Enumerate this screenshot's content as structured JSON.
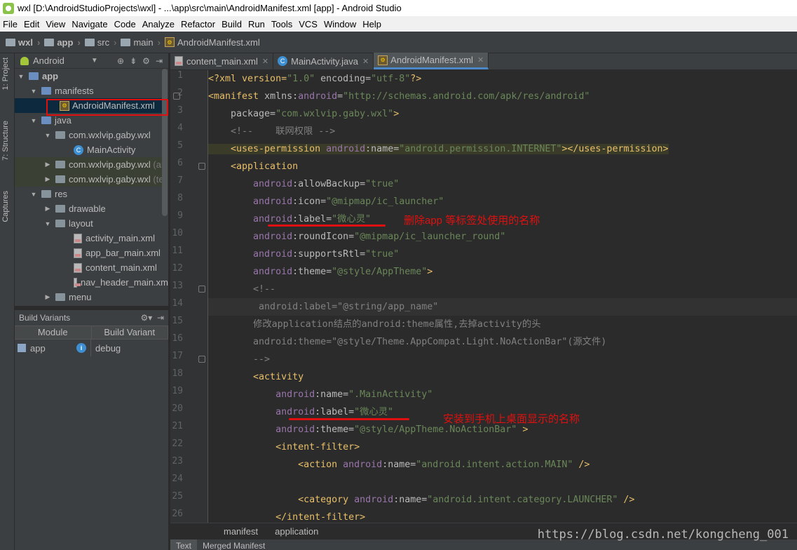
{
  "window": {
    "title": "wxl [D:\\AndroidStudioProjects\\wxl] - ...\\app\\src\\main\\AndroidManifest.xml [app] - Android Studio"
  },
  "menu": [
    "File",
    "Edit",
    "View",
    "Navigate",
    "Code",
    "Analyze",
    "Refactor",
    "Build",
    "Run",
    "Tools",
    "VCS",
    "Window",
    "Help"
  ],
  "breadcrumb": [
    "wxl",
    "app",
    "src",
    "main",
    "AndroidManifest.xml"
  ],
  "toolstrip": {
    "project": "1: Project",
    "structure": "7: Structure",
    "captures": "Captures"
  },
  "project_panel": {
    "view": "Android",
    "tree": {
      "app": "app",
      "manifests": "manifests",
      "manifest_file": "AndroidManifest.xml",
      "java": "java",
      "pkg1": "com.wxlvip.gaby.wxl",
      "main_activity": "MainActivity",
      "pkg2": "com.wxlvip.gaby.wxl",
      "pkg2_suffix": "(an",
      "pkg3": "com.wxlvip.gaby.wxl",
      "pkg3_suffix": "(te",
      "res": "res",
      "drawable": "drawable",
      "layout": "layout",
      "l1": "activity_main.xml",
      "l2": "app_bar_main.xml",
      "l3": "content_main.xml",
      "l4": "nav_header_main.xm",
      "menu": "menu"
    }
  },
  "build_variants": {
    "title": "Build Variants",
    "col_module": "Module",
    "col_variant": "Build Variant",
    "module": "app",
    "variant": "debug"
  },
  "tabs": [
    {
      "label": "content_main.xml"
    },
    {
      "label": "MainActivity.java"
    },
    {
      "label": "AndroidManifest.xml"
    }
  ],
  "editor": {
    "line_numbers": [
      "1",
      "2",
      "3",
      "4",
      "5",
      "6",
      "7",
      "8",
      "9",
      "10",
      "11",
      "12",
      "13",
      "14",
      "15",
      "16",
      "17",
      "18",
      "19",
      "20",
      "21",
      "22",
      "23",
      "24",
      "25",
      "26"
    ],
    "l1_a": "<?xml version=",
    "l1_b": "\"1.0\"",
    "l1_c": " encoding=",
    "l1_d": "\"utf-8\"",
    "l1_e": "?>",
    "l2_a": "<manifest ",
    "l2_b": "xmlns:",
    "l2_c": "android",
    "l2_d": "=",
    "l2_e": "\"http://schemas.android.com/apk/res/android\"",
    "l3_a": "    package=",
    "l3_b": "\"com.wxlvip.gaby.wxl\"",
    "l3_c": ">",
    "l4": "    <!--    联网权限 -->",
    "l5_a": "    <uses-permission ",
    "l5_b": "android",
    "l5_c": ":name=",
    "l5_d": "\"android.permission.INTERNET\"",
    "l5_e": "></uses-permission>",
    "l6": "    <application",
    "l7_a": "        android",
    "l7_b": ":allowBackup=",
    "l7_c": "\"true\"",
    "l8_a": "        android",
    "l8_b": ":icon=",
    "l8_c": "\"@mipmap/ic_launcher\"",
    "l9_a": "        android",
    "l9_b": ":label=",
    "l9_c": "\"微心灵\"",
    "l10_a": "        android",
    "l10_b": ":roundIcon=",
    "l10_c": "\"@mipmap/ic_launcher_round\"",
    "l11_a": "        android",
    "l11_b": ":supportsRtl=",
    "l11_c": "\"true\"",
    "l12_a": "        android",
    "l12_b": ":theme=",
    "l12_c": "\"@style/AppTheme\"",
    "l12_d": ">",
    "l13": "        <!--",
    "l14": "         android:label=\"@string/app_name\"",
    "l15": "        修改application结点的android:theme属性,去掉activity的头",
    "l16": "        android:theme=\"@style/Theme.AppCompat.Light.NoActionBar\"(源文件)",
    "l17": "        -->",
    "l18": "        <activity",
    "l19_a": "            android",
    "l19_b": ":name=",
    "l19_c": "\".MainActivity\"",
    "l20_a": "            android",
    "l20_b": ":label=",
    "l20_c": "\"微心灵\"",
    "l21_a": "            android",
    "l21_b": ":theme=",
    "l21_c": "\"@style/AppTheme.NoActionBar\"",
    "l21_d": " >",
    "l22": "            <intent-filter>",
    "l23_a": "                <action ",
    "l23_b": "android",
    "l23_c": ":name=",
    "l23_d": "\"android.intent.action.MAIN\"",
    "l23_e": " />",
    "l24": "",
    "l25_a": "                <category ",
    "l25_b": "android",
    "l25_c": ":name=",
    "l25_d": "\"android.intent.category.LAUNCHER\"",
    "l25_e": " />",
    "l26": "            </intent-filter>"
  },
  "annotations": {
    "a1": "删除app 等标签处使用的名称",
    "a2": "安装到手机上桌面显示的名称",
    "color": "#e01010"
  },
  "editor_breadcrumb": [
    "manifest",
    "application"
  ],
  "bottom_tabs": [
    "Text",
    "Merged Manifest"
  ],
  "watermark": "https://blog.csdn.net/kongcheng_001"
}
